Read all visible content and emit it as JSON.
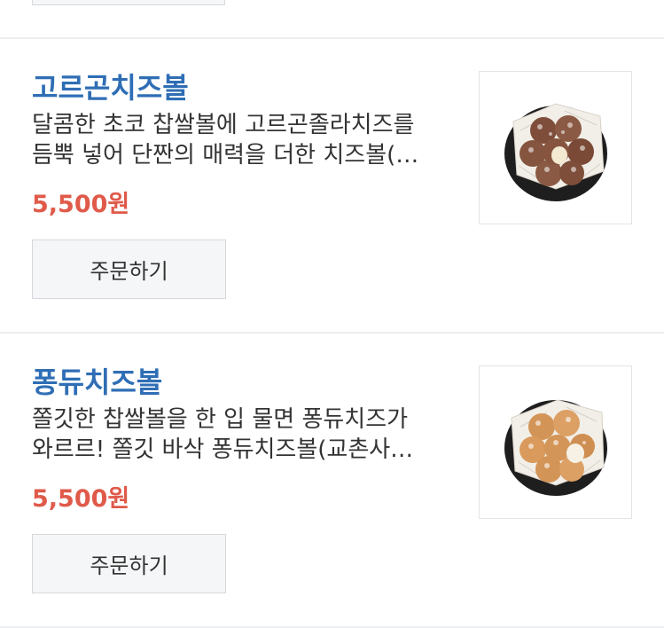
{
  "items": [
    {
      "title": "고르곤치즈볼",
      "desc_line1": "달콤한 초코 찹쌀볼에 고르곤졸라치즈를",
      "desc_line2": "듬뿍 넣어 단짠의 매력을 더한 치즈볼(…",
      "price": "5,500원",
      "order_label": "주문하기",
      "ball_color": "#8b5a44",
      "plate_color": "#1e1e1e"
    },
    {
      "title": "퐁듀치즈볼",
      "desc_line1": "쫄깃한 찹쌀볼을 한 입 물면 퐁듀치즈가",
      "desc_line2": "와르르! 쫄깃 바삭 퐁듀치즈볼(교촌사…",
      "price": "5,500원",
      "order_label": "주문하기",
      "ball_color": "#d99a5c",
      "plate_color": "#1e1e1e"
    }
  ],
  "colors": {
    "title": "#2f6eb5",
    "price": "#e05a4a",
    "divider": "#eceef1",
    "button_bg": "#f5f6f8"
  }
}
